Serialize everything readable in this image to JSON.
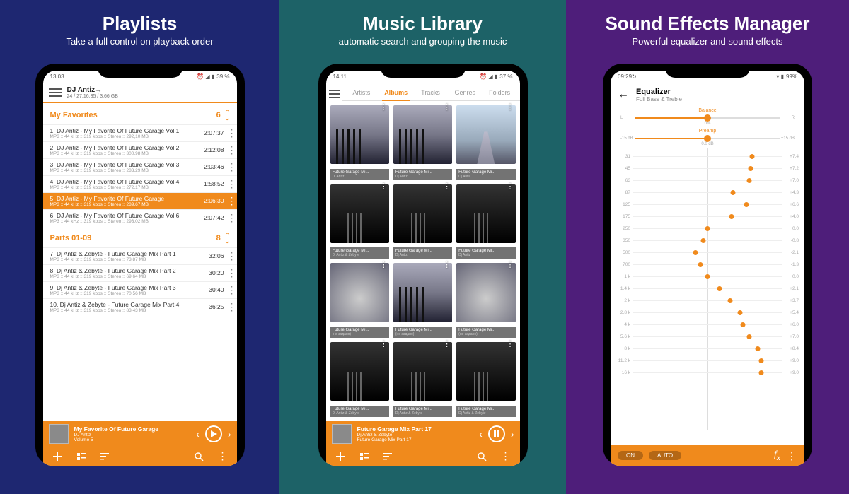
{
  "panels": [
    {
      "title": "Playlists",
      "subtitle": "Take a full control\non playback order"
    },
    {
      "title": "Music Library",
      "subtitle": "automatic search and grouping the music"
    },
    {
      "title": "Sound Effects Manager",
      "subtitle": "Powerful equalizer and sound effects"
    }
  ],
  "screen1": {
    "status_time": "13:03",
    "status_battery": "39 %",
    "header_title": "DJ Antiz→",
    "header_sub": "24 / 27:16:35 / 3,66 GB",
    "playlists": [
      {
        "name": "My Favorites",
        "count": "6",
        "tracks": [
          {
            "n": "1",
            "title": "DJ Antiz - My Favorite Of Future Garage Vol.1",
            "meta": "MP3 :: 44 kHz :: 319 kbps :: Stereo :: 292,10 MB",
            "dur": "2:07:37",
            "active": false
          },
          {
            "n": "2",
            "title": "DJ Antiz - My Favorite Of Future Garage Vol.2",
            "meta": "MP3 :: 44 kHz :: 319 kbps :: Stereo :: 300,98 MB",
            "dur": "2:12:08",
            "active": false
          },
          {
            "n": "3",
            "title": "DJ Antiz - My Favorite Of Future Garage Vol.3",
            "meta": "MP3 :: 44 kHz :: 319 kbps :: Stereo :: 283,29 MB",
            "dur": "2:03:46",
            "active": false
          },
          {
            "n": "4",
            "title": "DJ Antiz - My Favorite Of Future Garage Vol.4",
            "meta": "MP3 :: 44 kHz :: 319 kbps :: Stereo :: 272,17 MB",
            "dur": "1:58:52",
            "active": false
          },
          {
            "n": "5",
            "title": "DJ Antiz - My Favorite Of Future Garage",
            "meta": "MP3 :: 44 kHz :: 319 kbps :: Stereo :: 289,67 MB",
            "dur": "2:06:30",
            "active": true
          },
          {
            "n": "6",
            "title": "DJ Antiz - My Favorite Of Future Garage Vol.6",
            "meta": "MP3 :: 44 kHz :: 319 kbps :: Stereo :: 293,02 MB",
            "dur": "2:07:42",
            "active": false
          }
        ]
      },
      {
        "name": "Parts 01-09",
        "count": "8",
        "tracks": [
          {
            "n": "7",
            "title": "Dj Antiz & Zebyte - Future Garage Mix Part 1",
            "meta": "MP3 :: 44 kHz :: 319 kbps :: Stereo :: 73,87 MB",
            "dur": "32:06",
            "active": false
          },
          {
            "n": "8",
            "title": "Dj Antiz & Zebyte - Future Garage Mix Part 2",
            "meta": "MP3 :: 44 kHz :: 319 kbps :: Stereo :: 69,64 MB",
            "dur": "30:20",
            "active": false
          },
          {
            "n": "9",
            "title": "Dj Antiz & Zebyte - Future Garage Mix Part 3",
            "meta": "MP3 :: 44 kHz :: 319 kbps :: Stereo :: 70,56 MB",
            "dur": "30:40",
            "active": false
          },
          {
            "n": "10",
            "title": "Dj Antiz & Zebyte - Future Garage Mix Part 4",
            "meta": "MP3 :: 44 kHz :: 319 kbps :: Stereo :: 83,43 MB",
            "dur": "36:25",
            "active": false
          }
        ]
      }
    ],
    "now_title": "My Favorite Of Future Garage",
    "now_artist": "DJ Antiz",
    "now_album": "Volume 5"
  },
  "screen2": {
    "status_time": "14:11",
    "status_battery": "37 %",
    "tabs": [
      "Artists",
      "Albums",
      "Tracks",
      "Genres",
      "Folders"
    ],
    "active_tab": 1,
    "albums": [
      {
        "title": "Future Garage Mi...",
        "artist": "Dj Antiz",
        "cover": "forest"
      },
      {
        "title": "Future Garage Mi...",
        "artist": "Dj Antiz",
        "cover": "forest"
      },
      {
        "title": "Future Garage Mi...",
        "artist": "Dj Antiz",
        "cover": "path"
      },
      {
        "title": "Future Garage Mi...",
        "artist": "Dj Antiz & Zebyte",
        "cover": "dark"
      },
      {
        "title": "Future Garage Mi...",
        "artist": "Dj Antiz",
        "cover": "dark"
      },
      {
        "title": "Future Garage Mi...",
        "artist": "Dj Antiz",
        "cover": "dark"
      },
      {
        "title": "Future Garage Mi...",
        "artist": "(не задано)",
        "cover": "mist"
      },
      {
        "title": "Future Garage Mi...",
        "artist": "(не задано)",
        "cover": "forest"
      },
      {
        "title": "Future Garage Mi...",
        "artist": "(не задано)",
        "cover": "mist"
      },
      {
        "title": "Future Garage Mi...",
        "artist": "Dj Antiz & Zebyte",
        "cover": "dark"
      },
      {
        "title": "Future Garage Mi...",
        "artist": "Dj Antiz & Zebyte",
        "cover": "dark"
      },
      {
        "title": "Future Garage Mi...",
        "artist": "Dj Antiz & Zebyte",
        "cover": "dark"
      }
    ],
    "now_title": "Future Garage Mix Part 17",
    "now_artist": "Dj Antiz & Zebyte",
    "now_album": "Future Garage Mix Part 17"
  },
  "screen3": {
    "status_time": "09:29",
    "status_battery": "99%",
    "title": "Equalizer",
    "subtitle": "Full Bass & Treble",
    "balance_label": "Balance",
    "balance_value": "0%",
    "balance_left": "L",
    "balance_right": "R",
    "preamp_label": "Preamp",
    "preamp_value": "0.0 dB",
    "preamp_left": "-15 dB",
    "preamp_right": "+15 dB",
    "bands": [
      {
        "freq": "31",
        "value": "+7.4",
        "pos": 80
      },
      {
        "freq": "45",
        "value": "+7.2",
        "pos": 79
      },
      {
        "freq": "63",
        "value": "+7.0",
        "pos": 78
      },
      {
        "freq": "87",
        "value": "+4.3",
        "pos": 67
      },
      {
        "freq": "125",
        "value": "+6.6",
        "pos": 76
      },
      {
        "freq": "175",
        "value": "+4.0",
        "pos": 66
      },
      {
        "freq": "250",
        "value": "0.0",
        "pos": 50
      },
      {
        "freq": "350",
        "value": "-0.8",
        "pos": 47
      },
      {
        "freq": "500",
        "value": "-2.1",
        "pos": 42
      },
      {
        "freq": "700",
        "value": "-1.3",
        "pos": 45
      },
      {
        "freq": "1 k",
        "value": "0.0",
        "pos": 50
      },
      {
        "freq": "1.4 k",
        "value": "+2.1",
        "pos": 58
      },
      {
        "freq": "2 k",
        "value": "+3.7",
        "pos": 65
      },
      {
        "freq": "2.8 k",
        "value": "+5.4",
        "pos": 72
      },
      {
        "freq": "4 k",
        "value": "+6.0",
        "pos": 74
      },
      {
        "freq": "5.6 k",
        "value": "+7.0",
        "pos": 78
      },
      {
        "freq": "8 k",
        "value": "+8.4",
        "pos": 84
      },
      {
        "freq": "11.2 k",
        "value": "+9.0",
        "pos": 86
      },
      {
        "freq": "16 k",
        "value": "+9.0",
        "pos": 86
      }
    ],
    "btn_on": "ON",
    "btn_auto": "AUTO"
  }
}
